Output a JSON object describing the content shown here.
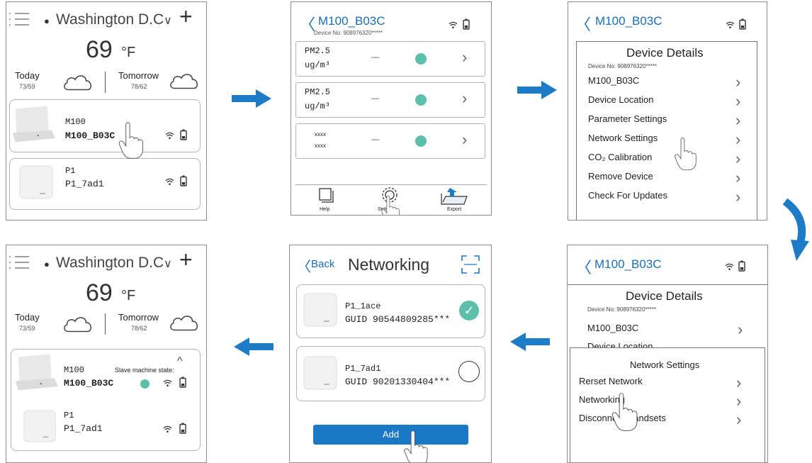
{
  "home": {
    "location": "Washington D.C",
    "temperature": "69",
    "unit": "°F",
    "today_label": "Today",
    "today_range": "73/59",
    "tomorrow_label": "Tomorrow",
    "tomorrow_range": "78/62",
    "devices": [
      {
        "model": "M100",
        "name": "M100_B03C"
      },
      {
        "model": "P1",
        "name": "P1_7ad1"
      }
    ],
    "slave_state_label": "Slave machine state:"
  },
  "sensors_screen": {
    "title": "M100_B03C",
    "device_no": "Device No: 908976320*****",
    "rows": [
      {
        "label1": "PM2.5",
        "label2": "ug/m³",
        "value": "——"
      },
      {
        "label1": "PM2.5",
        "label2": "ug/m³",
        "value": "——"
      },
      {
        "label1": "xxxx",
        "label2": "xxxx",
        "value": "——"
      }
    ],
    "toolbar": {
      "help": "Help",
      "settings": "Settings",
      "export": "Export"
    }
  },
  "details": {
    "title": "M100_B03C",
    "heading": "Device Details",
    "device_no": "Device No: 908976320*****",
    "items": [
      "M100_B03C",
      "Device Location",
      "Parameter Settings",
      "Network Settings",
      "CO₂ Calibration",
      "Remove Device",
      "Check For Updates"
    ]
  },
  "network_settings": {
    "heading": "Network Settings",
    "items": [
      "Rerset Network",
      "Networking",
      "Disconnect Handsets"
    ]
  },
  "networking": {
    "back": "Back",
    "title": "Networking",
    "devices": [
      {
        "name": "P1_1ace",
        "guid": "GUID 90544809285***",
        "checked": true
      },
      {
        "name": "P1_7ad1",
        "guid": "GUID 90201330404***",
        "checked": false
      }
    ],
    "add_button": "Add"
  },
  "colors": {
    "accent": "#1b78c4",
    "status_dot": "#5cbfaa",
    "arrow": "#1e7cc6"
  }
}
